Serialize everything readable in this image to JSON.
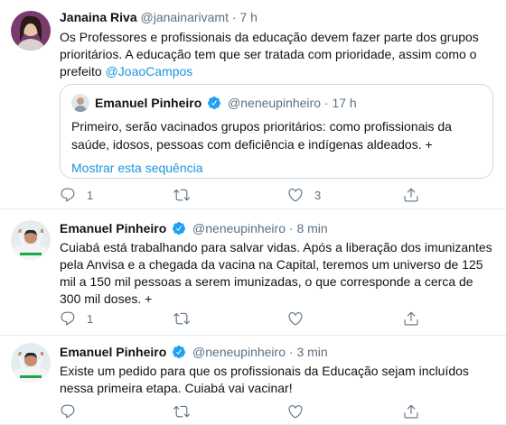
{
  "tweets": [
    {
      "name": "Janaina Riva",
      "handle": "@janainarivamt",
      "dot": "·",
      "time": "7 h",
      "text_before": "Os Professores e profissionais da educação devem fazer parte dos grupos prioritários. A educação tem que ser tratada com prioridade, assim como o prefeito ",
      "mention": "@JoaoCampos",
      "quote": {
        "name": "Emanuel Pinheiro",
        "handle": "@neneupinheiro",
        "dot": "·",
        "time": "17 h",
        "text": "Primeiro, serão vacinados grupos prioritários: como profissionais da saúde, idosos, pessoas com deficiência e indígenas aldeados. +",
        "show_thread": "Mostrar esta sequência"
      },
      "replies": "1",
      "retweets": "",
      "likes": "3"
    },
    {
      "name": "Emanuel Pinheiro",
      "handle": "@neneupinheiro",
      "dot": "·",
      "time": "8 min",
      "text": "Cuiabá está trabalhando para salvar vidas. Após a liberação dos imunizantes pela Anvisa e a chegada da vacina na Capital, teremos um universo de 125 mil a 150 mil pessoas a serem imunizadas, o que corresponde a cerca de 300 mil doses. +",
      "replies": "1",
      "retweets": "",
      "likes": ""
    },
    {
      "name": "Emanuel Pinheiro",
      "handle": "@neneupinheiro",
      "dot": "·",
      "time": "3 min",
      "text": "Existe um pedido para que os profissionais da Educação sejam incluídos nessa primeira etapa. Cuiabá vai vacinar!",
      "replies": "",
      "retweets": "",
      "likes": ""
    }
  ],
  "colors": {
    "link": "#1b95e0",
    "verified": "#1da1f2",
    "muted": "#5b7083",
    "border": "#e6ecf0"
  },
  "icons": [
    "reply-icon",
    "retweet-icon",
    "like-icon",
    "share-icon",
    "verified-badge-icon"
  ]
}
